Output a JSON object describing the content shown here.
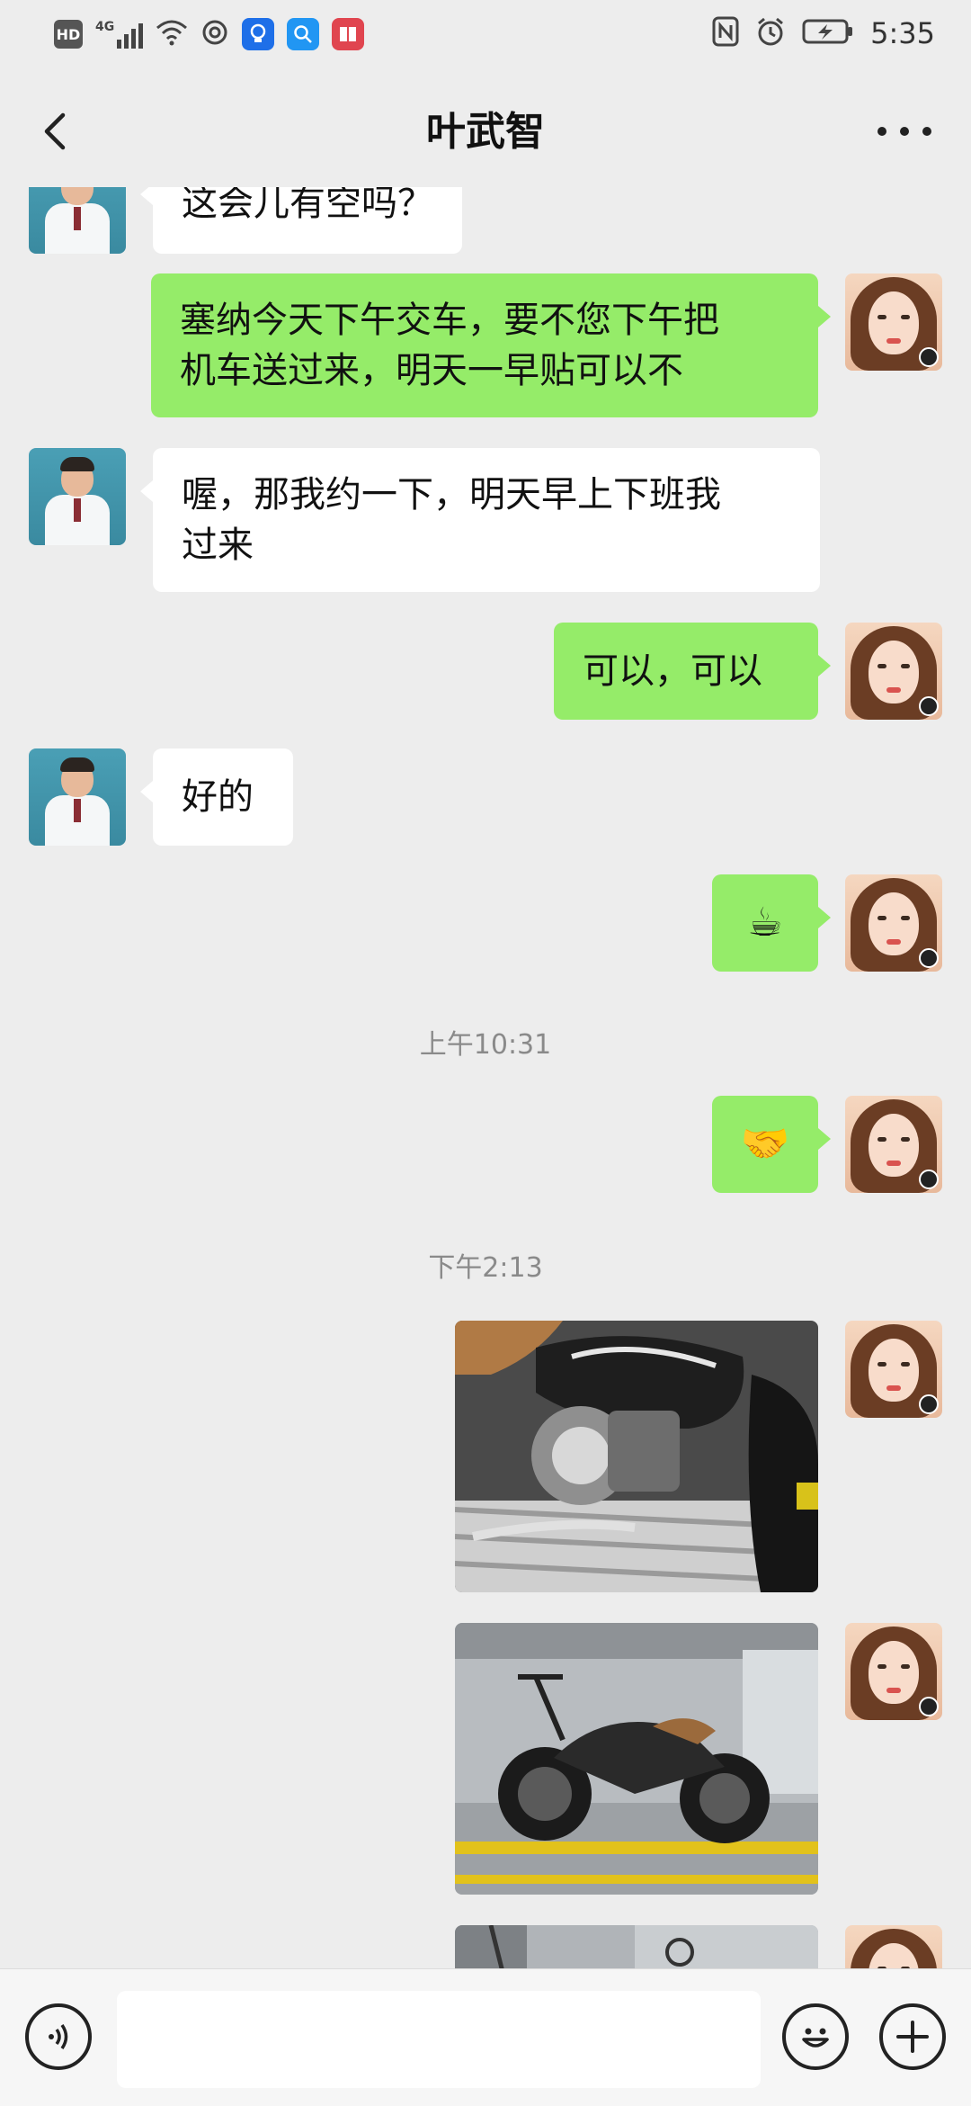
{
  "status_bar": {
    "left_icons": [
      "hd-icon",
      "4g-signal-icon",
      "wifi-icon",
      "hotspot-icon",
      "bulb-app-icon",
      "search-app-icon",
      "book-app-icon"
    ],
    "hd_label": "HD",
    "net_label": "4G",
    "right_icons": [
      "nfc-icon",
      "alarm-icon",
      "battery-charging-icon"
    ],
    "time": "5:35"
  },
  "header": {
    "title": "叶武智",
    "back_icon": "chevron-left-icon",
    "more_icon": "more-dots-icon"
  },
  "messages": [
    {
      "sender": "contact",
      "text": "这会儿有空吗？"
    },
    {
      "sender": "me",
      "text_lines": [
        "塞纳今天下午交车，要不您下午把",
        "机车送过来，明天一早贴可以不"
      ]
    },
    {
      "sender": "contact",
      "text_lines": [
        "喔，那我约一下，明天早上下班我",
        "过来"
      ]
    },
    {
      "sender": "me",
      "text": "可以，可以"
    },
    {
      "sender": "contact",
      "text": "好的"
    },
    {
      "sender": "me",
      "emoji": "☕"
    },
    {
      "type": "timestamp",
      "text": "上午10:31"
    },
    {
      "sender": "me",
      "emoji": "🤝"
    },
    {
      "type": "timestamp",
      "text": "下午2:13"
    },
    {
      "sender": "me",
      "image": "motorcycle-engine-closeup"
    },
    {
      "sender": "me",
      "image": "motorcycle-side-view-showroom"
    },
    {
      "sender": "me",
      "image": "motorcycle-showroom-partial"
    }
  ],
  "bottom_bar": {
    "voice_icon": "voice-icon",
    "input_value": "",
    "emoji_icon": "emoji-face-icon",
    "plus_icon": "plus-icon"
  },
  "colors": {
    "background": "#ededed",
    "my_bubble": "#95ec69",
    "their_bubble": "#ffffff",
    "timestamp_text": "#8a8a8a"
  }
}
